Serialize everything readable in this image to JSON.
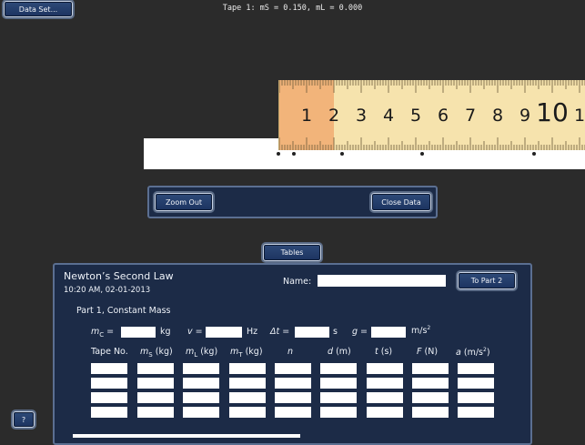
{
  "toolbar": {
    "dataset_label": "Data Set...",
    "status": "Tape 1: mS = 0.150, mL = 0.000"
  },
  "ruler": {
    "numbers": [
      "1",
      "2",
      "3",
      "4",
      "5",
      "6",
      "7",
      "8",
      "9",
      "10",
      "1"
    ]
  },
  "zoom_panel": {
    "zoom_out_label": "Zoom Out",
    "close_data_label": "Close Data"
  },
  "tables_label": "Tables",
  "table": {
    "title": "Newton’s Second Law",
    "time": "10:20 AM, 02-01-2013",
    "name_label": "Name:",
    "to_part2_label": "To Part 2",
    "part_heading": "Part 1, Constant Mass",
    "mc_symbol": "m",
    "mc_sub": "C",
    "mc_unit": "kg",
    "v_symbol": "v",
    "v_unit": "Hz",
    "dt_symbol": "Δt",
    "dt_unit": "s",
    "g_symbol": "g",
    "g_unit": "m/s",
    "g_unit_sup": "2",
    "columns": {
      "tape": "Tape No.",
      "ms": "m",
      "ms_sub": "S",
      "ms_unit": "(kg)",
      "ml": "m",
      "ml_sub": "L",
      "ml_unit": "(kg)",
      "mt": "m",
      "mt_sub": "T",
      "mt_unit": "(kg)",
      "n": "n",
      "d": "d",
      "d_unit": "(m)",
      "t": "t",
      "t_unit": "(s)",
      "f": "F",
      "f_unit": "(N)",
      "a": "a",
      "a_unit": "(m/s",
      "a_sup": "2",
      "a_close": ")"
    }
  },
  "help_label": "?"
}
